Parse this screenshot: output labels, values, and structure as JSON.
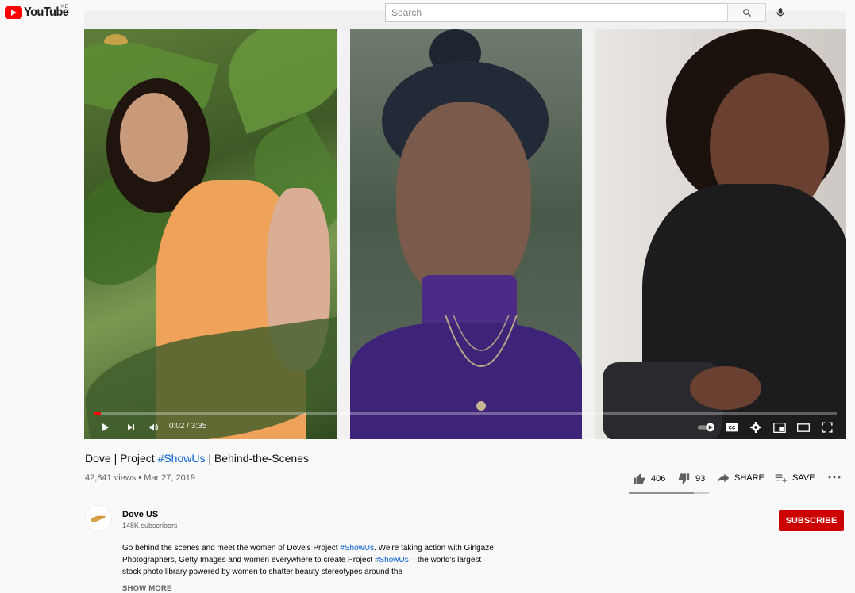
{
  "masthead": {
    "logo_text": "YouTube",
    "country_code": "KE",
    "search_placeholder": "Search",
    "icons": {
      "search": "search-icon",
      "mic": "microphone-icon"
    }
  },
  "player": {
    "progress": 0.01,
    "time_display": "0:02 / 3:35",
    "icons": [
      "play-icon",
      "next-icon",
      "volume-icon",
      "autoplay-toggle-icon",
      "captions-icon",
      "settings-icon",
      "miniplayer-icon",
      "theater-mode-icon",
      "fullscreen-icon"
    ]
  },
  "video": {
    "title_pre": "Dove | Project ",
    "title_hashtag": "#ShowUs",
    "title_post": " | Behind-the-Scenes",
    "views": "42,841 views",
    "separator": " • ",
    "date": "Mar 27, 2019"
  },
  "actions": {
    "like_count": "406",
    "dislike_count": "93",
    "share_label": "SHARE",
    "save_label": "SAVE",
    "like_ratio": 0.81
  },
  "channel": {
    "name": "Dove US",
    "subscribers": "148K subscribers",
    "subscribe_label": "SUBSCRIBE"
  },
  "description": {
    "part1": "Go behind the scenes and meet the women of Dove's Project ",
    "hashtag1": "#ShowUs",
    "part2": ". We're taking action with Girlgaze Photographers, Getty Images and women everywhere to create Project ",
    "hashtag2": "#ShowUs",
    "part3": " – the world's largest stock photo library powered by women to shatter beauty stereotypes around the",
    "show_more": "SHOW MORE"
  },
  "colors": {
    "brand_red": "#ff0000",
    "subscribe_red": "#cc0000",
    "link_blue": "#065fd4"
  }
}
